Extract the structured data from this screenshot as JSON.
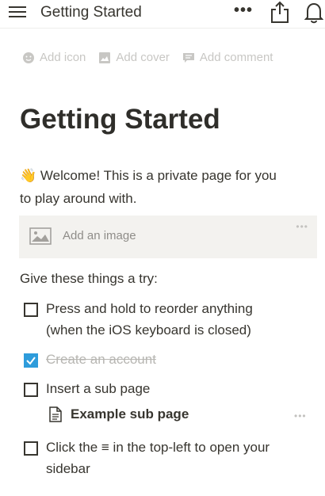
{
  "topbar": {
    "title": "Getting Started",
    "more_label": "•••"
  },
  "meta": {
    "add_icon": "Add icon",
    "add_cover": "Add cover",
    "add_comment": "Add comment"
  },
  "page": {
    "title": "Getting Started",
    "welcome_emoji": "👋",
    "welcome_line1": "Welcome! This is a private page for you",
    "welcome_line2": "to play around with.",
    "image_placeholder": "Add an image",
    "image_more": "•••",
    "give_heading": "Give these things a try:"
  },
  "todos": [
    {
      "line1": "Press and hold to reorder anything",
      "line2": "(when the iOS keyboard is closed)",
      "checked": false
    },
    {
      "line1": "Create an account",
      "checked": true
    },
    {
      "line1": "Insert a sub page",
      "checked": false
    },
    {
      "line1": "Click the ≡ in the top-left to open your",
      "line2": "sidebar",
      "checked": false
    }
  ],
  "subpage": {
    "label": "Example sub page",
    "more": "•••"
  },
  "colors": {
    "text": "#37352f",
    "muted": "#c8c7c4",
    "checkbox_checked": "#2e9cdb",
    "image_block_bg": "#f3f2ef"
  }
}
